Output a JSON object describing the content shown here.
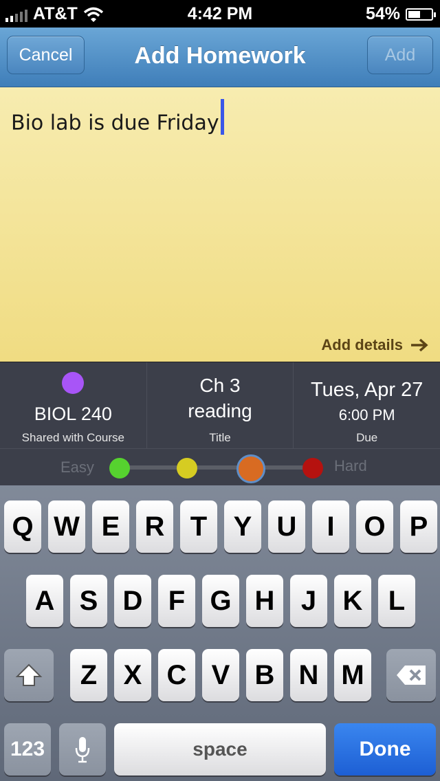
{
  "status_bar": {
    "carrier": "AT&T",
    "time": "4:42 PM",
    "battery_percent": "54%",
    "battery_level": 0.54,
    "signal_bars": 2
  },
  "navbar": {
    "title": "Add Homework",
    "cancel_label": "Cancel",
    "add_label": "Add"
  },
  "note": {
    "text": "Bio lab is due Friday",
    "add_details_label": "Add details"
  },
  "info": {
    "course_name": "BIOL 240",
    "course_sub": "Shared with Course",
    "course_color": "#a855f7",
    "title_line1": "Ch 3",
    "title_line2": "reading",
    "title_sub": "Title",
    "due_date": "Tues, Apr 27",
    "due_time": "6:00 PM",
    "due_sub": "Due"
  },
  "difficulty": {
    "easy_label": "Easy",
    "hard_label": "Hard",
    "levels": [
      "#56d22f",
      "#d6cc22",
      "#d86b22",
      "#b5120f"
    ],
    "selected_index": 2
  },
  "keyboard": {
    "row1": [
      "Q",
      "W",
      "E",
      "R",
      "T",
      "Y",
      "U",
      "I",
      "O",
      "P"
    ],
    "row2": [
      "A",
      "S",
      "D",
      "F",
      "G",
      "H",
      "J",
      "K",
      "L"
    ],
    "row3": [
      "Z",
      "X",
      "C",
      "V",
      "B",
      "N",
      "M"
    ],
    "numbers_label": "123",
    "space_label": "space",
    "done_label": "Done"
  }
}
